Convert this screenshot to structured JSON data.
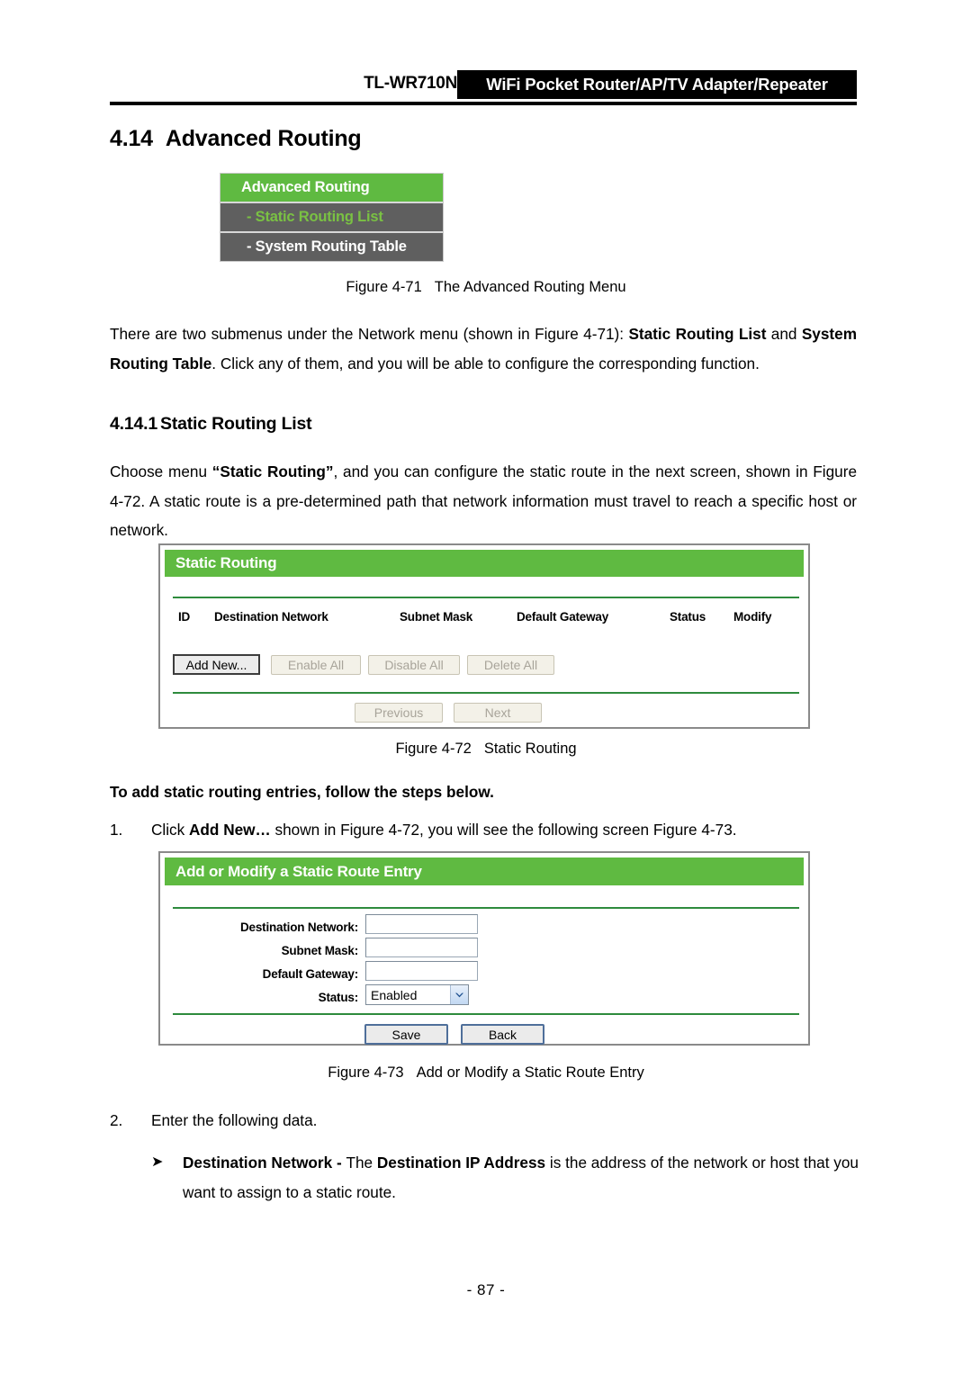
{
  "header": {
    "model": "TL-WR710N",
    "banner": "WiFi Pocket Router/AP/TV Adapter/Repeater"
  },
  "section": {
    "number": "4.14",
    "title": "Advanced Routing"
  },
  "menu_figure": {
    "header": "Advanced Routing",
    "items": [
      {
        "label": "- Static Routing List",
        "state": "active"
      },
      {
        "label": "- System Routing Table",
        "state": "plain"
      }
    ]
  },
  "captions": {
    "fig71_num": "Figure 4-71",
    "fig71_text": "The Advanced Routing Menu",
    "fig72_num": "Figure 4-72",
    "fig72_text": "Static Routing",
    "fig73_num": "Figure 4-73",
    "fig73_text": "Add or Modify a Static Route Entry"
  },
  "paragraphs": {
    "intro_html": "There are two submenus under the Network menu (shown in Figure 4-71): <b>Static Routing List</b> and <b>System Routing Table</b>. Click any of them, and you will be able to configure the corresponding function.",
    "choose_html": "Choose menu <b>&ldquo;Static Routing&rdquo;</b>, and you can configure the static route in the next screen, shown in Figure 4-72. A static route is a pre-determined path that network information must travel to reach a specific host or network.",
    "steps_lead": "To add static routing entries, follow the steps below.",
    "step1_marker": "1.",
    "step1_html": "Click <b>Add New&hellip;</b> shown in Figure 4-72, you will see the following screen Figure 4-73.",
    "step2_marker": "2.",
    "step2_html": "Enter the following data.",
    "bullet1_arrow": "➤",
    "bullet1_html": "<b>Destination Network - </b>The <b>Destination IP Address</b> is the address of the network or host that you want to assign to a static route."
  },
  "subsection": {
    "number": "4.14.1",
    "title": "Static Routing List"
  },
  "static_routing_panel": {
    "title": "Static Routing",
    "columns": [
      "ID",
      "Destination Network",
      "Subnet Mask",
      "Default Gateway",
      "Status",
      "Modify"
    ],
    "buttons": [
      "Add New...",
      "Enable All",
      "Disable All",
      "Delete All"
    ],
    "pager": [
      "Previous",
      "Next"
    ]
  },
  "modify_panel": {
    "title": "Add or Modify a Static Route Entry",
    "fields": [
      {
        "label": "Destination Network:",
        "value": ""
      },
      {
        "label": "Subnet Mask:",
        "value": ""
      },
      {
        "label": "Default Gateway:",
        "value": ""
      }
    ],
    "status": {
      "label": "Status:",
      "value": "Enabled"
    },
    "buttons": [
      "Save",
      "Back"
    ]
  },
  "footer": {
    "page_number": "- 87 -"
  },
  "colors": {
    "green_header": "#5fba41",
    "green_rule": "#2e8b3d",
    "menu_gray": "#5f5f5f",
    "menu_active_text": "#7ac143",
    "banner_black": "#000000"
  }
}
